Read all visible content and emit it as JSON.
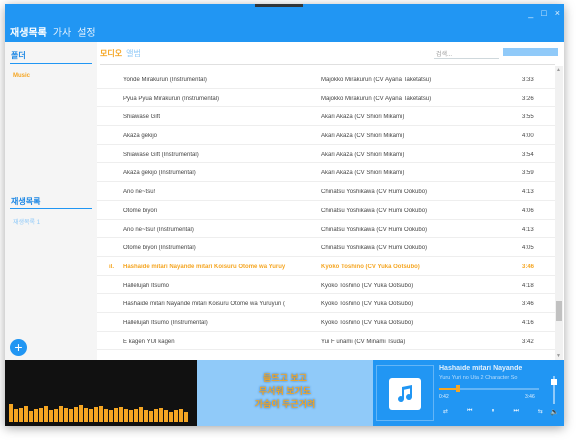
{
  "menu": {
    "items": [
      "재생목록",
      "가사",
      "설정"
    ]
  },
  "sidebar": {
    "folder_header": "폴더",
    "folder_items": [
      "Music"
    ],
    "playlist_header": "재생목록",
    "playlist_items": [
      "재생목록 1"
    ],
    "add_label": "+"
  },
  "tabs": {
    "active": "모디오",
    "inactive": "앨범"
  },
  "search": {
    "placeholder": "검색..."
  },
  "tracks": [
    {
      "title": "Yonde Mirakurun (Instrumental)",
      "artist": "Majokko Mirakurun (CV Ayana Taketatsu)",
      "time": "3:33"
    },
    {
      "title": "Pyua Pyua Mirakurun (Instrumental)",
      "artist": "Majokko Mirakurun (CV Ayana Taketatsu)",
      "time": "3:26"
    },
    {
      "title": "Shiawase Gift",
      "artist": "Akari Akaza (CV Shiori Mikami)",
      "time": "3:55"
    },
    {
      "title": "Akaza gekijō",
      "artist": "Akari Akaza (CV Shiori Mikami)",
      "time": "4:00"
    },
    {
      "title": "Shiawase Gift (Instrumental)",
      "artist": "Akari Akaza (CV Shiori Mikami)",
      "time": "3:54"
    },
    {
      "title": "Akaza gekijō (Instrumental)",
      "artist": "Akari Akaza (CV Shiori Mikami)",
      "time": "3:59"
    },
    {
      "title": "Ano ne~tsu!",
      "artist": "Chinatsu Yoshikawa (CV Rumi Ookubo)",
      "time": "4:13"
    },
    {
      "title": "Otome biyori",
      "artist": "Chinatsu Yoshikawa (CV Rumi Ookubo)",
      "time": "4:06"
    },
    {
      "title": "Ano ne~tsu! (Instrumental)",
      "artist": "Chinatsu Yoshikawa (CV Rumi Ookubo)",
      "time": "4:13"
    },
    {
      "title": "Otome biyori (Instrumental)",
      "artist": "Chinatsu Yoshikawa (CV Rumi Ookubo)",
      "time": "4:05"
    },
    {
      "title": "Hashaide mitari Nayande mitari Koisuru Otome wa Yuruy",
      "artist": "Kyoko Toshino (CV Yuka Ootsubo)",
      "time": "3:46",
      "playing": true
    },
    {
      "title": "Hallelujah Itsumo",
      "artist": "Kyoko Toshino (CV Yuka Ootsubo)",
      "time": "4:18"
    },
    {
      "title": "Hashaide mitari Nayande mitari Koisuru Otome wa Yuruyuri (",
      "artist": "Kyoko Toshino (CV Yuka Ootsubo)",
      "time": "3:46"
    },
    {
      "title": "Hallelujah Itsumo (Instrumental)",
      "artist": "Kyoko Toshino (CV Yuka Ootsubo)",
      "time": "4:16"
    },
    {
      "title": "E kagen YUI kagen",
      "artist": "Yui F unami (CV Minami Tsuda)",
      "time": "3:42"
    }
  ],
  "visualizer": {
    "levels": [
      0.55,
      0.4,
      0.45,
      0.5,
      0.35,
      0.4,
      0.45,
      0.5,
      0.38,
      0.42,
      0.5,
      0.45,
      0.4,
      0.48,
      0.52,
      0.44,
      0.4,
      0.46,
      0.5,
      0.42,
      0.38,
      0.44,
      0.48,
      0.4,
      0.36,
      0.42,
      0.46,
      0.38,
      0.34,
      0.4,
      0.44,
      0.36,
      0.3,
      0.36,
      0.4,
      0.32
    ]
  },
  "lyrics": {
    "lines": [
      "들뜨고 보고",
      "무서워 보기도",
      "가슴이 두근거려"
    ]
  },
  "now_playing": {
    "title": "Hashaide mitari Nayande",
    "subtitle": "Yuru Yuri no Uta 2 Character So",
    "current_time": "0:42",
    "total_time": "3:46",
    "progress": 0.19,
    "volume": 0.85,
    "controls": [
      "셔플",
      "이전",
      "일시정지",
      "다음",
      "반복"
    ],
    "control_glyphs": [
      "⇄",
      "⏮",
      "⏸",
      "⏭",
      "⇆"
    ]
  },
  "window_controls": [
    "_",
    "□",
    "×"
  ],
  "colors": {
    "accent": "#2196f3",
    "highlight": "#f5a623",
    "light": "#90caf9"
  }
}
